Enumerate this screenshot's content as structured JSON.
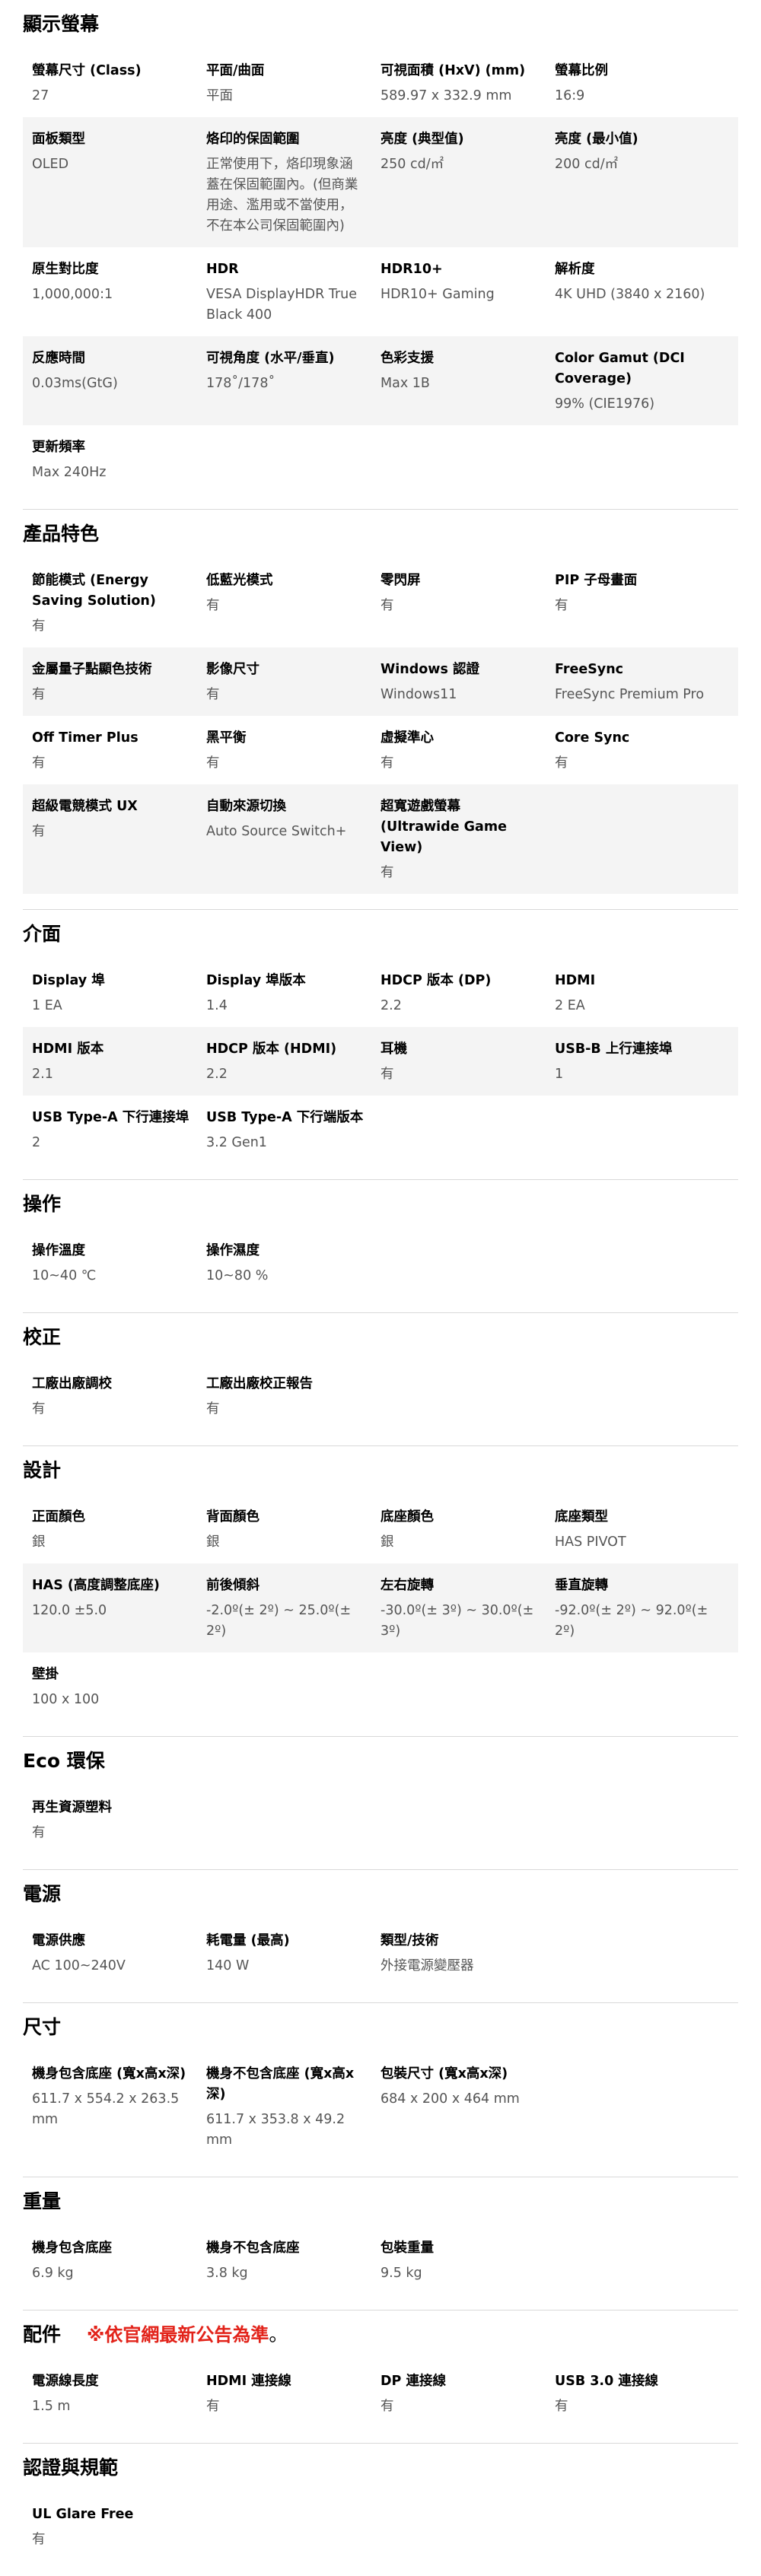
{
  "sections": [
    {
      "title": "顯示螢幕",
      "rows": [
        [
          {
            "label": "螢幕尺寸 (Class)",
            "value": "27"
          },
          {
            "label": "平面/曲面",
            "value": "平面"
          },
          {
            "label": "可視面積 (HxV) (mm)",
            "value": "589.97 x 332.9 mm"
          },
          {
            "label": "螢幕比例",
            "value": "16:9"
          }
        ],
        [
          {
            "label": "面板類型",
            "value": "OLED"
          },
          {
            "label": "烙印的保固範圍",
            "value": "正常使用下，烙印現象涵蓋在保固範圍內。(但商業用途、濫用或不當使用，不在本公司保固範圍內)"
          },
          {
            "label": "亮度 (典型值)",
            "value": "250 cd/㎡"
          },
          {
            "label": "亮度 (最小值)",
            "value": "200 cd/㎡"
          }
        ],
        [
          {
            "label": "原生對比度",
            "value": "1,000,000:1"
          },
          {
            "label": "HDR",
            "value": "VESA DisplayHDR True Black 400"
          },
          {
            "label": "HDR10+",
            "value": "HDR10+ Gaming"
          },
          {
            "label": "解析度",
            "value": "4K UHD (3840 x 2160)"
          }
        ],
        [
          {
            "label": "反應時間",
            "value": "0.03ms(GtG)"
          },
          {
            "label": "可視角度 (水平/垂直)",
            "value": "178˚/178˚"
          },
          {
            "label": "色彩支援",
            "value": "Max 1B"
          },
          {
            "label": "Color Gamut (DCI Coverage)",
            "value": "99% (CIE1976)"
          }
        ],
        [
          {
            "label": "更新頻率",
            "value": "Max 240Hz"
          }
        ]
      ]
    },
    {
      "title": "產品特色",
      "rows": [
        [
          {
            "label": "節能模式 (Energy Saving Solution)",
            "value": "有"
          },
          {
            "label": "低藍光模式",
            "value": "有"
          },
          {
            "label": "零閃屏",
            "value": "有"
          },
          {
            "label": "PIP 子母畫面",
            "value": "有"
          }
        ],
        [
          {
            "label": "金屬量子點顯色技術",
            "value": "有"
          },
          {
            "label": "影像尺寸",
            "value": "有"
          },
          {
            "label": "Windows 認證",
            "value": "Windows11"
          },
          {
            "label": "FreeSync",
            "value": "FreeSync Premium Pro"
          }
        ],
        [
          {
            "label": "Off Timer Plus",
            "value": "有"
          },
          {
            "label": "黑平衡",
            "value": "有"
          },
          {
            "label": "虛擬準心",
            "value": "有"
          },
          {
            "label": "Core Sync",
            "value": "有"
          }
        ],
        [
          {
            "label": "超級電競模式 UX",
            "value": "有"
          },
          {
            "label": "自動來源切換",
            "value": "Auto Source Switch+"
          },
          {
            "label": "超寬遊戲螢幕 (Ultrawide Game View)",
            "value": "有"
          }
        ]
      ]
    },
    {
      "title": "介面",
      "rows": [
        [
          {
            "label": "Display 埠",
            "value": "1 EA"
          },
          {
            "label": "Display 埠版本",
            "value": "1.4"
          },
          {
            "label": "HDCP 版本 (DP)",
            "value": "2.2"
          },
          {
            "label": "HDMI",
            "value": "2 EA"
          }
        ],
        [
          {
            "label": "HDMI 版本",
            "value": "2.1"
          },
          {
            "label": "HDCP 版本 (HDMI)",
            "value": "2.2"
          },
          {
            "label": "耳機",
            "value": "有"
          },
          {
            "label": "USB-B 上行連接埠",
            "value": "1"
          }
        ],
        [
          {
            "label": "USB Type-A 下行連接埠",
            "value": "2"
          },
          {
            "label": "USB Type-A 下行端版本",
            "value": "3.2 Gen1"
          }
        ]
      ]
    },
    {
      "title": "操作",
      "rows": [
        [
          {
            "label": "操作溫度",
            "value": "10~40 ℃"
          },
          {
            "label": "操作濕度",
            "value": "10~80 %"
          }
        ]
      ]
    },
    {
      "title": "校正",
      "rows": [
        [
          {
            "label": "工廠出廠調校",
            "value": "有"
          },
          {
            "label": "工廠出廠校正報告",
            "value": "有"
          }
        ]
      ]
    },
    {
      "title": "設計",
      "rows": [
        [
          {
            "label": "正面顏色",
            "value": "銀"
          },
          {
            "label": "背面顏色",
            "value": "銀"
          },
          {
            "label": "底座顏色",
            "value": "銀"
          },
          {
            "label": "底座類型",
            "value": "HAS PIVOT"
          }
        ],
        [
          {
            "label": "HAS (高度調整底座)",
            "value": "120.0 ±5.0"
          },
          {
            "label": "前後傾斜",
            "value": "-2.0º(± 2º) ~ 25.0º(± 2º)"
          },
          {
            "label": "左右旋轉",
            "value": "-30.0º(± 3º) ~ 30.0º(± 3º)"
          },
          {
            "label": "垂直旋轉",
            "value": "-92.0º(± 2º) ~ 92.0º(± 2º)"
          }
        ],
        [
          {
            "label": "壁掛",
            "value": "100 x 100"
          }
        ]
      ]
    },
    {
      "title": "Eco 環保",
      "rows": [
        [
          {
            "label": "再生資源塑料",
            "value": "有"
          }
        ]
      ]
    },
    {
      "title": "電源",
      "rows": [
        [
          {
            "label": "電源供應",
            "value": "AC 100~240V"
          },
          {
            "label": "耗電量 (最高)",
            "value": "140 W"
          },
          {
            "label": "類型/技術",
            "value": "外接電源變壓器"
          }
        ]
      ]
    },
    {
      "title": "尺寸",
      "rows": [
        [
          {
            "label": "機身包含底座 (寬x高x深)",
            "value": "611.7 x 554.2 x 263.5 mm"
          },
          {
            "label": "機身不包含底座 (寬x高x深)",
            "value": "611.7 x 353.8 x 49.2 mm"
          },
          {
            "label": "包裝尺寸 (寬x高x深)",
            "value": "684 x 200 x 464 mm"
          }
        ]
      ]
    },
    {
      "title": "重量",
      "rows": [
        [
          {
            "label": "機身包含底座",
            "value": "6.9 kg"
          },
          {
            "label": "機身不包含底座",
            "value": "3.8 kg"
          },
          {
            "label": "包裝重量",
            "value": "9.5 kg"
          }
        ]
      ]
    },
    {
      "title": "配件",
      "notice": "※依官網最新公告為準",
      "notice_dot": "。",
      "rows": [
        [
          {
            "label": "電源線長度",
            "value": "1.5 m"
          },
          {
            "label": "HDMI 連接線",
            "value": "有"
          },
          {
            "label": "DP 連接線",
            "value": "有"
          },
          {
            "label": "USB 3.0 連接線",
            "value": "有"
          }
        ]
      ]
    },
    {
      "title": "認證與規範",
      "rows": [
        [
          {
            "label": "UL Glare Free",
            "value": "有"
          }
        ]
      ]
    }
  ]
}
